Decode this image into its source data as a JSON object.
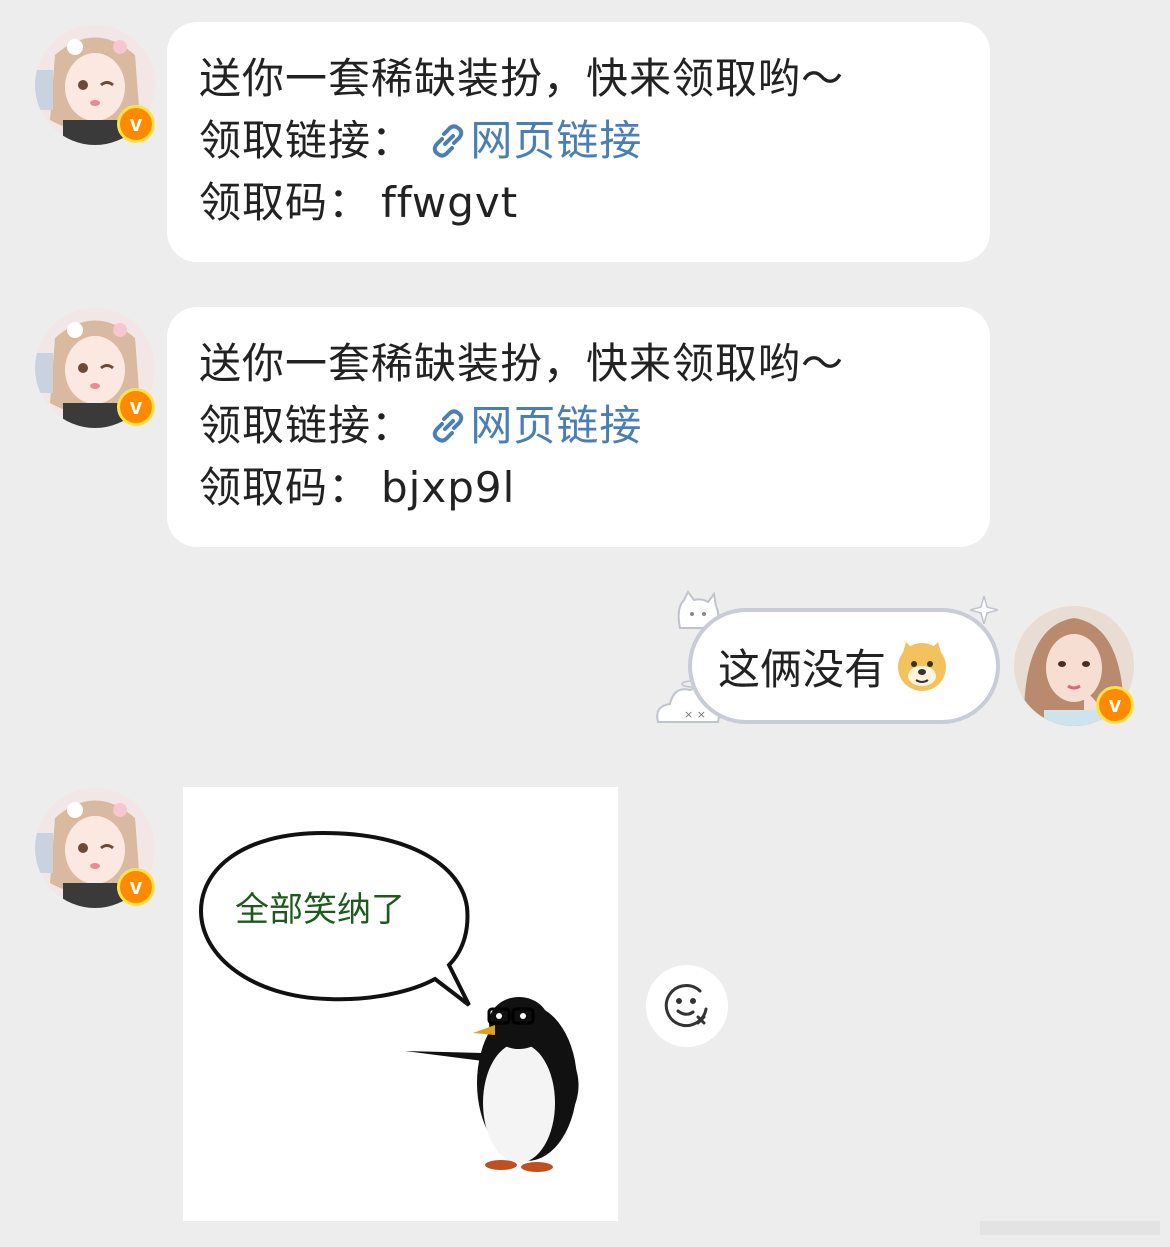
{
  "messages": [
    {
      "side": "left",
      "line1": "送你一套稀缺装扮，快来领取哟～",
      "link_prefix": "领取链接：",
      "link_text": "网页链接",
      "code_prefix": "领取码：",
      "code": "ffwgvt"
    },
    {
      "side": "left",
      "line1": "送你一套稀缺装扮，快来领取哟～",
      "link_prefix": "领取链接：",
      "link_text": "网页链接",
      "code_prefix": "领取码：",
      "code": "bjxp9l"
    }
  ],
  "sent": {
    "text": "这俩没有",
    "emoji": "doge-emoji"
  },
  "image_message": {
    "caption": "全部笑纳了",
    "subject": "penguin-with-glasses"
  },
  "badge": {
    "letter": "v",
    "color": "#ff8a00",
    "ring": "#ffe24a"
  },
  "icons": [
    "link-icon",
    "add-reaction-icon",
    "doge-emoji",
    "verified-badge-icon"
  ],
  "colors": {
    "background": "#ededed",
    "bubble": "#ffffff",
    "link": "#4a7fb5",
    "caption": "#1d5a1d"
  }
}
